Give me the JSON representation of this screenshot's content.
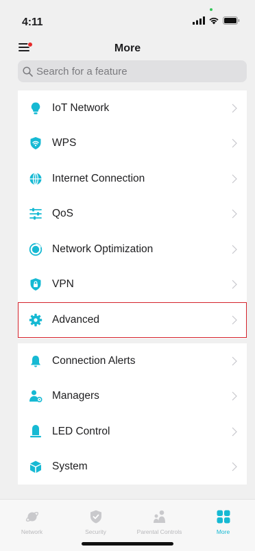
{
  "status_bar": {
    "time": "4:11"
  },
  "header": {
    "title": "More"
  },
  "search": {
    "placeholder": "Search for a feature",
    "value": ""
  },
  "menu_group_1": [
    {
      "label": "IoT Network",
      "icon": "lightbulb-icon"
    },
    {
      "label": "WPS",
      "icon": "wps-shield-icon"
    },
    {
      "label": "Internet Connection",
      "icon": "globe-icon"
    },
    {
      "label": "QoS",
      "icon": "sliders-icon"
    },
    {
      "label": "Network Optimization",
      "icon": "optimization-icon"
    },
    {
      "label": "VPN",
      "icon": "vpn-shield-icon"
    },
    {
      "label": "Advanced",
      "icon": "gear-icon",
      "highlighted": true
    }
  ],
  "menu_group_2": [
    {
      "label": "Connection Alerts",
      "icon": "bell-icon"
    },
    {
      "label": "Managers",
      "icon": "managers-icon"
    },
    {
      "label": "LED Control",
      "icon": "led-icon"
    },
    {
      "label": "System",
      "icon": "cube-icon"
    }
  ],
  "tabbar": [
    {
      "label": "Network",
      "icon": "network-planet-icon",
      "active": false
    },
    {
      "label": "Security",
      "icon": "security-shield-icon",
      "active": false
    },
    {
      "label": "Parental Controls",
      "icon": "parental-controls-icon",
      "active": false
    },
    {
      "label": "More",
      "icon": "grid-icon",
      "active": true
    }
  ],
  "colors": {
    "accent": "#16b9d3",
    "highlight_border": "#d4212a",
    "badge": "#e52a2a"
  }
}
